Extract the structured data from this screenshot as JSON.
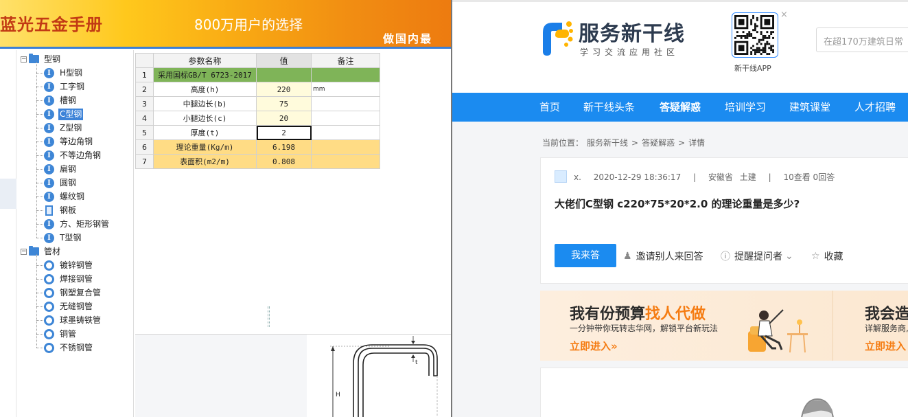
{
  "left_app": {
    "banner": {
      "title": "蓝光五金手册",
      "slogan": "800万用户的选择",
      "tagline": "做国内最"
    },
    "tree": {
      "groups": [
        {
          "label": "型钢",
          "items": [
            {
              "label": "H型钢",
              "icon": "ibeam-icon"
            },
            {
              "label": "工字钢",
              "icon": "ibeam-icon"
            },
            {
              "label": "槽钢",
              "icon": "ibeam-icon"
            },
            {
              "label": "C型钢",
              "icon": "ibeam-icon",
              "selected": true
            },
            {
              "label": "Z型钢",
              "icon": "ibeam-icon"
            },
            {
              "label": "等边角钢",
              "icon": "ibeam-icon"
            },
            {
              "label": "不等边角钢",
              "icon": "ibeam-icon"
            },
            {
              "label": "扁钢",
              "icon": "ibeam-icon"
            },
            {
              "label": "圆钢",
              "icon": "ibeam-icon"
            },
            {
              "label": "螺纹钢",
              "icon": "ibeam-icon"
            },
            {
              "label": "钢板",
              "icon": "plate-icon"
            },
            {
              "label": "方、矩形钢管",
              "icon": "ibeam-icon"
            },
            {
              "label": "T型钢",
              "icon": "ibeam-icon"
            }
          ]
        },
        {
          "label": "管材",
          "items": [
            {
              "label": "镀锌钢管",
              "icon": "pipe-icon"
            },
            {
              "label": "焊接钢管",
              "icon": "pipe-icon"
            },
            {
              "label": "钢塑复合管",
              "icon": "pipe-icon"
            },
            {
              "label": "无缝钢管",
              "icon": "pipe-icon"
            },
            {
              "label": "球墨铸铁管",
              "icon": "pipe-icon"
            },
            {
              "label": "铜管",
              "icon": "pipe-icon"
            },
            {
              "label": "不锈钢管",
              "icon": "pipe-icon"
            }
          ]
        }
      ]
    },
    "table": {
      "headers": [
        "参数名称",
        "值",
        "备注"
      ],
      "rows": [
        {
          "n": "1",
          "name": "采用国标GB/T 6723-2017",
          "value": "",
          "remark": "",
          "kind": "std"
        },
        {
          "n": "2",
          "name": "高度(h)",
          "value": "220",
          "remark": "mm",
          "kind": "in"
        },
        {
          "n": "3",
          "name": "中腿边长(b)",
          "value": "75",
          "remark": "",
          "kind": "in"
        },
        {
          "n": "4",
          "name": "小腿边长(c)",
          "value": "20",
          "remark": "",
          "kind": "in"
        },
        {
          "n": "5",
          "name": "厚度(t)",
          "value": "2",
          "remark": "",
          "kind": "in",
          "active": true
        },
        {
          "n": "6",
          "name": "理论重量(Kg/m)",
          "value": "6.198",
          "remark": "",
          "kind": "out"
        },
        {
          "n": "7",
          "name": "表面积(m2/m)",
          "value": "0.808",
          "remark": "",
          "kind": "out"
        }
      ]
    },
    "diagram": {
      "label_h": "H",
      "label_t": "t"
    }
  },
  "right_app": {
    "logo": {
      "title": "服务新干线",
      "subtitle": "学习交流应用社区"
    },
    "qr": {
      "label": "新干线APP",
      "close": "×"
    },
    "search": {
      "placeholder": "在超170万建筑日常"
    },
    "nav": [
      {
        "label": "首页"
      },
      {
        "label": "新干线头条"
      },
      {
        "label": "答疑解惑",
        "active": true
      },
      {
        "label": "培训学习"
      },
      {
        "label": "建筑课堂"
      },
      {
        "label": "人才招聘"
      }
    ],
    "breadcrumb": {
      "prefix": "当前位置：",
      "items": [
        "服务新干线",
        ">",
        "答疑解惑",
        ">",
        "详情"
      ]
    },
    "question": {
      "user": "x.",
      "time": "2020-12-29 18:36:17",
      "sep": "|",
      "location": "安徽省",
      "category": "土建",
      "stats": "10查看  0回答",
      "title": "大佬们C型钢 c220*75*20*2.0 的理论重量是多少?",
      "answer_btn": "我来答",
      "invite": "邀请别人来回答",
      "remind": "提醒提问者",
      "favorite": "收藏"
    },
    "promo": {
      "title_a": "我有份预算",
      "title_b": "找人代做",
      "subtitle": "一分钟带你玩转志华网，解锁平台新玩法",
      "link": "立即进入»",
      "title2": "我会造",
      "subtitle2": "详解服务商,",
      "link2": "立即进入"
    }
  }
}
